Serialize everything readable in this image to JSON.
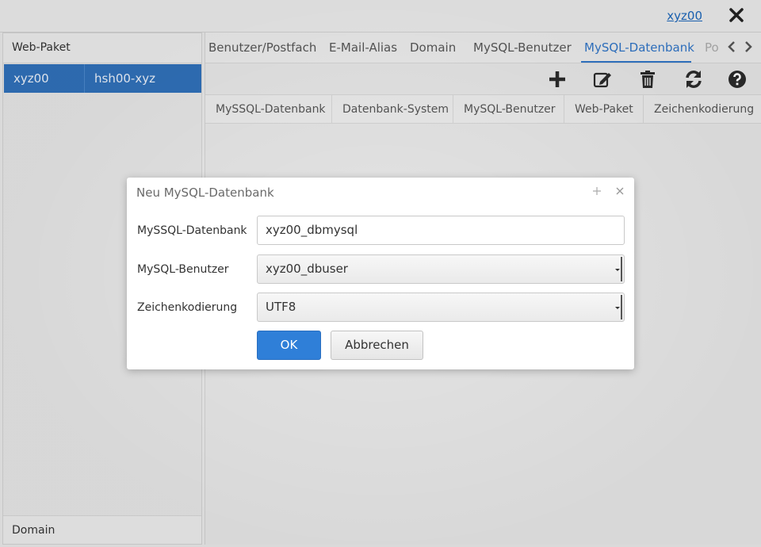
{
  "topbar": {
    "user": "xyz00"
  },
  "left": {
    "header": "Web-Paket",
    "row": {
      "col1": "xyz00",
      "col2": "hsh00-xyz"
    },
    "footer": "Domain"
  },
  "tabs": [
    {
      "label": "Benutzer/Postfach"
    },
    {
      "label": "E-Mail-Alias"
    },
    {
      "label": "Domain"
    },
    {
      "label": "MySQL-Benutzer"
    },
    {
      "label": "MySQL-Datenbank"
    },
    {
      "label": "Po"
    }
  ],
  "columns": [
    {
      "label": "MySSQL-Datenbank"
    },
    {
      "label": "Datenbank-System"
    },
    {
      "label": "MySQL-Benutzer"
    },
    {
      "label": "Web-Paket"
    },
    {
      "label": "Zeichenkodierung"
    }
  ],
  "dialog": {
    "title": "Neu MySQL-Datenbank",
    "fields": [
      {
        "label": "MySSQL-Datenbank",
        "value": "xyz00_dbmysql"
      },
      {
        "label": "MySQL-Benutzer",
        "value": "xyz00_dbuser"
      },
      {
        "label": "Zeichenkodierung",
        "value": "UTF8"
      }
    ],
    "ok": "OK",
    "cancel": "Abbrechen"
  },
  "colors": {
    "accent": "#2f73c4",
    "selection": "#2f6fb7",
    "ok_button": "#2f7fd8"
  }
}
